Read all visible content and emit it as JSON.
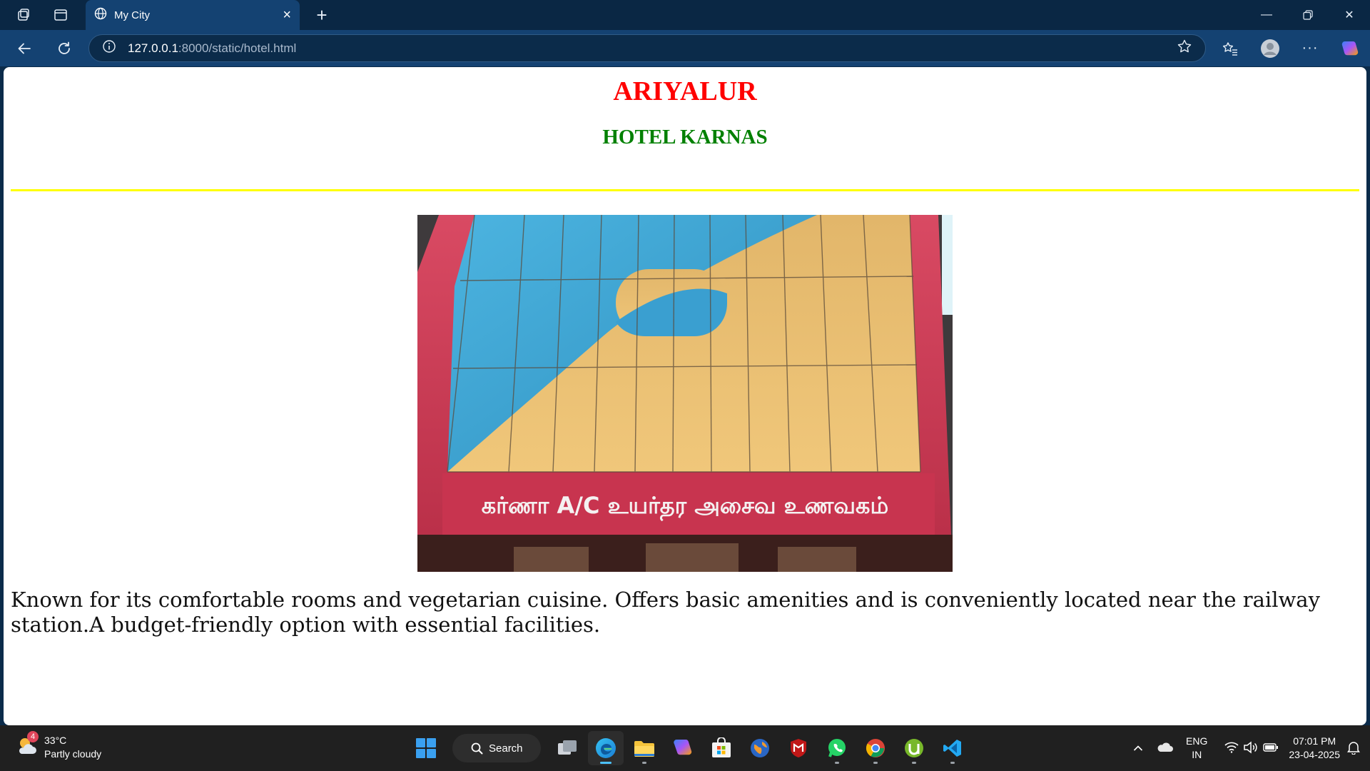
{
  "browser": {
    "tab_title": "My City",
    "url_host": "127.0.0.1",
    "url_path": ":8000/static/hotel.html"
  },
  "page": {
    "city": "ARIYALUR",
    "hotel_name": "HOTEL KARNAS",
    "image_sign_text": "கர்ணா A/C உயர்தர அசைவ உணவகம்",
    "description": "Known for its comfortable rooms and vegetarian cuisine. Offers basic amenities and is conveniently located near the railway station.A budget-friendly option with essential facilities."
  },
  "taskbar": {
    "weather_temp": "33°C",
    "weather_desc": "Partly cloudy",
    "weather_badge": "4",
    "search_label": "Search",
    "lang_line1": "ENG",
    "lang_line2": "IN",
    "time": "07:01 PM",
    "date": "23-04-2025"
  },
  "colors": {
    "city_heading": "#ff0000",
    "hotel_heading": "#008000",
    "divider": "#ffff00",
    "browser_frame": "#144272"
  }
}
